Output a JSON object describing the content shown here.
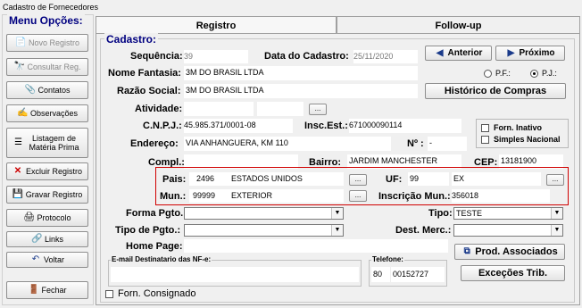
{
  "window": {
    "title": "Cadastro de Fornecedores"
  },
  "sidebar": {
    "legend": "Menu Opções:",
    "buttons": {
      "novo": "Novo Registro",
      "consultar": "Consultar Reg.",
      "contatos": "Contatos",
      "observacoes": "Observações",
      "listagem": "Listagem de Matéria Prima",
      "excluir": "Excluir Registro",
      "gravar": "Gravar Registro",
      "protocolo": "Protocolo",
      "links": "Links",
      "voltar": "Voltar",
      "fechar": "Fechar"
    }
  },
  "tabs": {
    "registro": "Registro",
    "followup": "Follow-up"
  },
  "cadastro": {
    "legend": "Cadastro:",
    "sequencia_label": "Sequência:",
    "sequencia": "39",
    "data_label": "Data do Cadastro:",
    "data": "25/11/2020",
    "anterior": "Anterior",
    "proximo": "Próximo",
    "fantasia_label": "Nome Fantasia:",
    "fantasia": "3M DO BRASIL LTDA",
    "pf_label": "P.F.:",
    "pj_label": "P.J.:",
    "razao_label": "Razão Social:",
    "razao": "3M DO BRASIL LTDA",
    "historico": "Histórico de Compras",
    "atividade_label": "Atividade:",
    "atividade": "",
    "dots": "...",
    "cnpj_label": "C.N.P.J.:",
    "cnpj": "45.985.371/0001-08",
    "insc_est_label": "Insc.Est.:",
    "insc_est": "671000090114",
    "forn_inativo": "Forn. Inativo",
    "simples": "Simples Nacional",
    "endereco_label": "Endereço:",
    "endereco": "VIA ANHANGUERA, KM 110",
    "numero_label": "Nº :",
    "numero": "-",
    "compl_label": "Compl.:",
    "bairro_label": "Bairro:",
    "bairro": "JARDIM MANCHESTER",
    "cep_label": "CEP:",
    "cep": "13181900",
    "pais_label": "Pais:",
    "pais_code": "2496",
    "pais": "ESTADOS UNIDOS",
    "uf_label": "UF:",
    "uf_code": "99",
    "uf": "EX",
    "mun_label": "Mun.:",
    "mun_code": "99999",
    "mun": "EXTERIOR",
    "insc_mun_label": "Inscrição Mun.:",
    "insc_mun": "356018",
    "forma_label": "Forma Pgto.:",
    "tipo_label": "Tipo:",
    "tipo": "TESTE",
    "tipo_pgto_label": "Tipo de Pgto.:",
    "dest_merc_label": "Dest. Merc.:",
    "homepage_label": "Home Page:",
    "prod_assoc": "Prod. Associados",
    "email_label": "E-mail Destinatario das NF-e:",
    "telefone_label": "Telefone:",
    "tel_ddd": "80",
    "tel_num": "00152727",
    "excecoes": "Exceções Trib.",
    "forn_consignado": "Forn. Consignado"
  }
}
